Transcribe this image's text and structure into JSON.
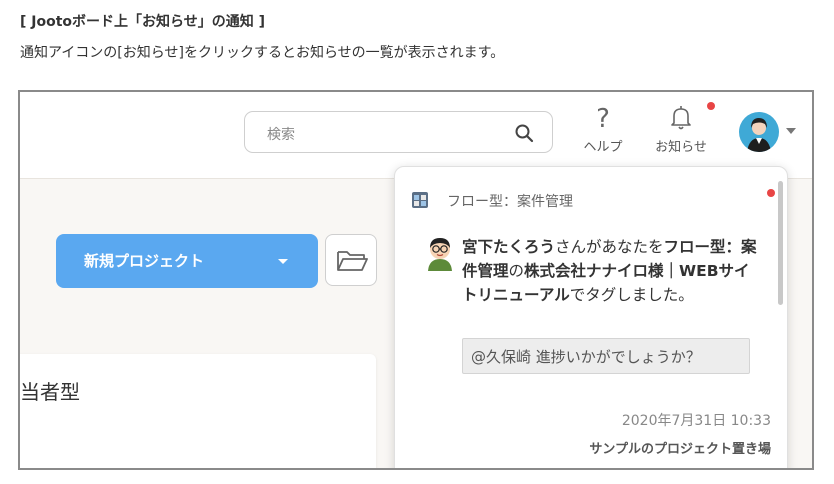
{
  "article": {
    "heading": "[ Jootoボード上「お知らせ」の通知 ]",
    "description": "通知アイコンの[お知らせ]をクリックするとお知らせの一覧が表示されます。"
  },
  "header": {
    "search_placeholder": "検索",
    "help_label": "ヘルプ",
    "notifications_label": "お知らせ",
    "help_glyph": "?"
  },
  "main": {
    "new_project_label": "新規プロジェクト",
    "card_text": "当者型"
  },
  "notification": {
    "project_name": "フロー型：案件管理",
    "sender": "宮下たくろう",
    "text_1": "さんがあなたを",
    "project_ref": "フロー型：案件管理",
    "text_2": "の",
    "company": "株式会社ナナイロ様｜WEBサイトリニューアル",
    "text_3": "でタグしました。",
    "quote": "@久保崎 進捗いかがでしょうか？",
    "date": "2020年7月31日 10:33",
    "project_link": "サンプルのプロジェクト置き場"
  },
  "colors": {
    "primary_button": "#5aa8f0",
    "unread_dot": "#e84545",
    "avatar_bg": "#3fa9d6"
  },
  "icons": [
    "search-icon",
    "help-icon",
    "bell-icon",
    "chevron-down-icon",
    "folder-icon",
    "project-icon",
    "person-avatar-icon"
  ]
}
